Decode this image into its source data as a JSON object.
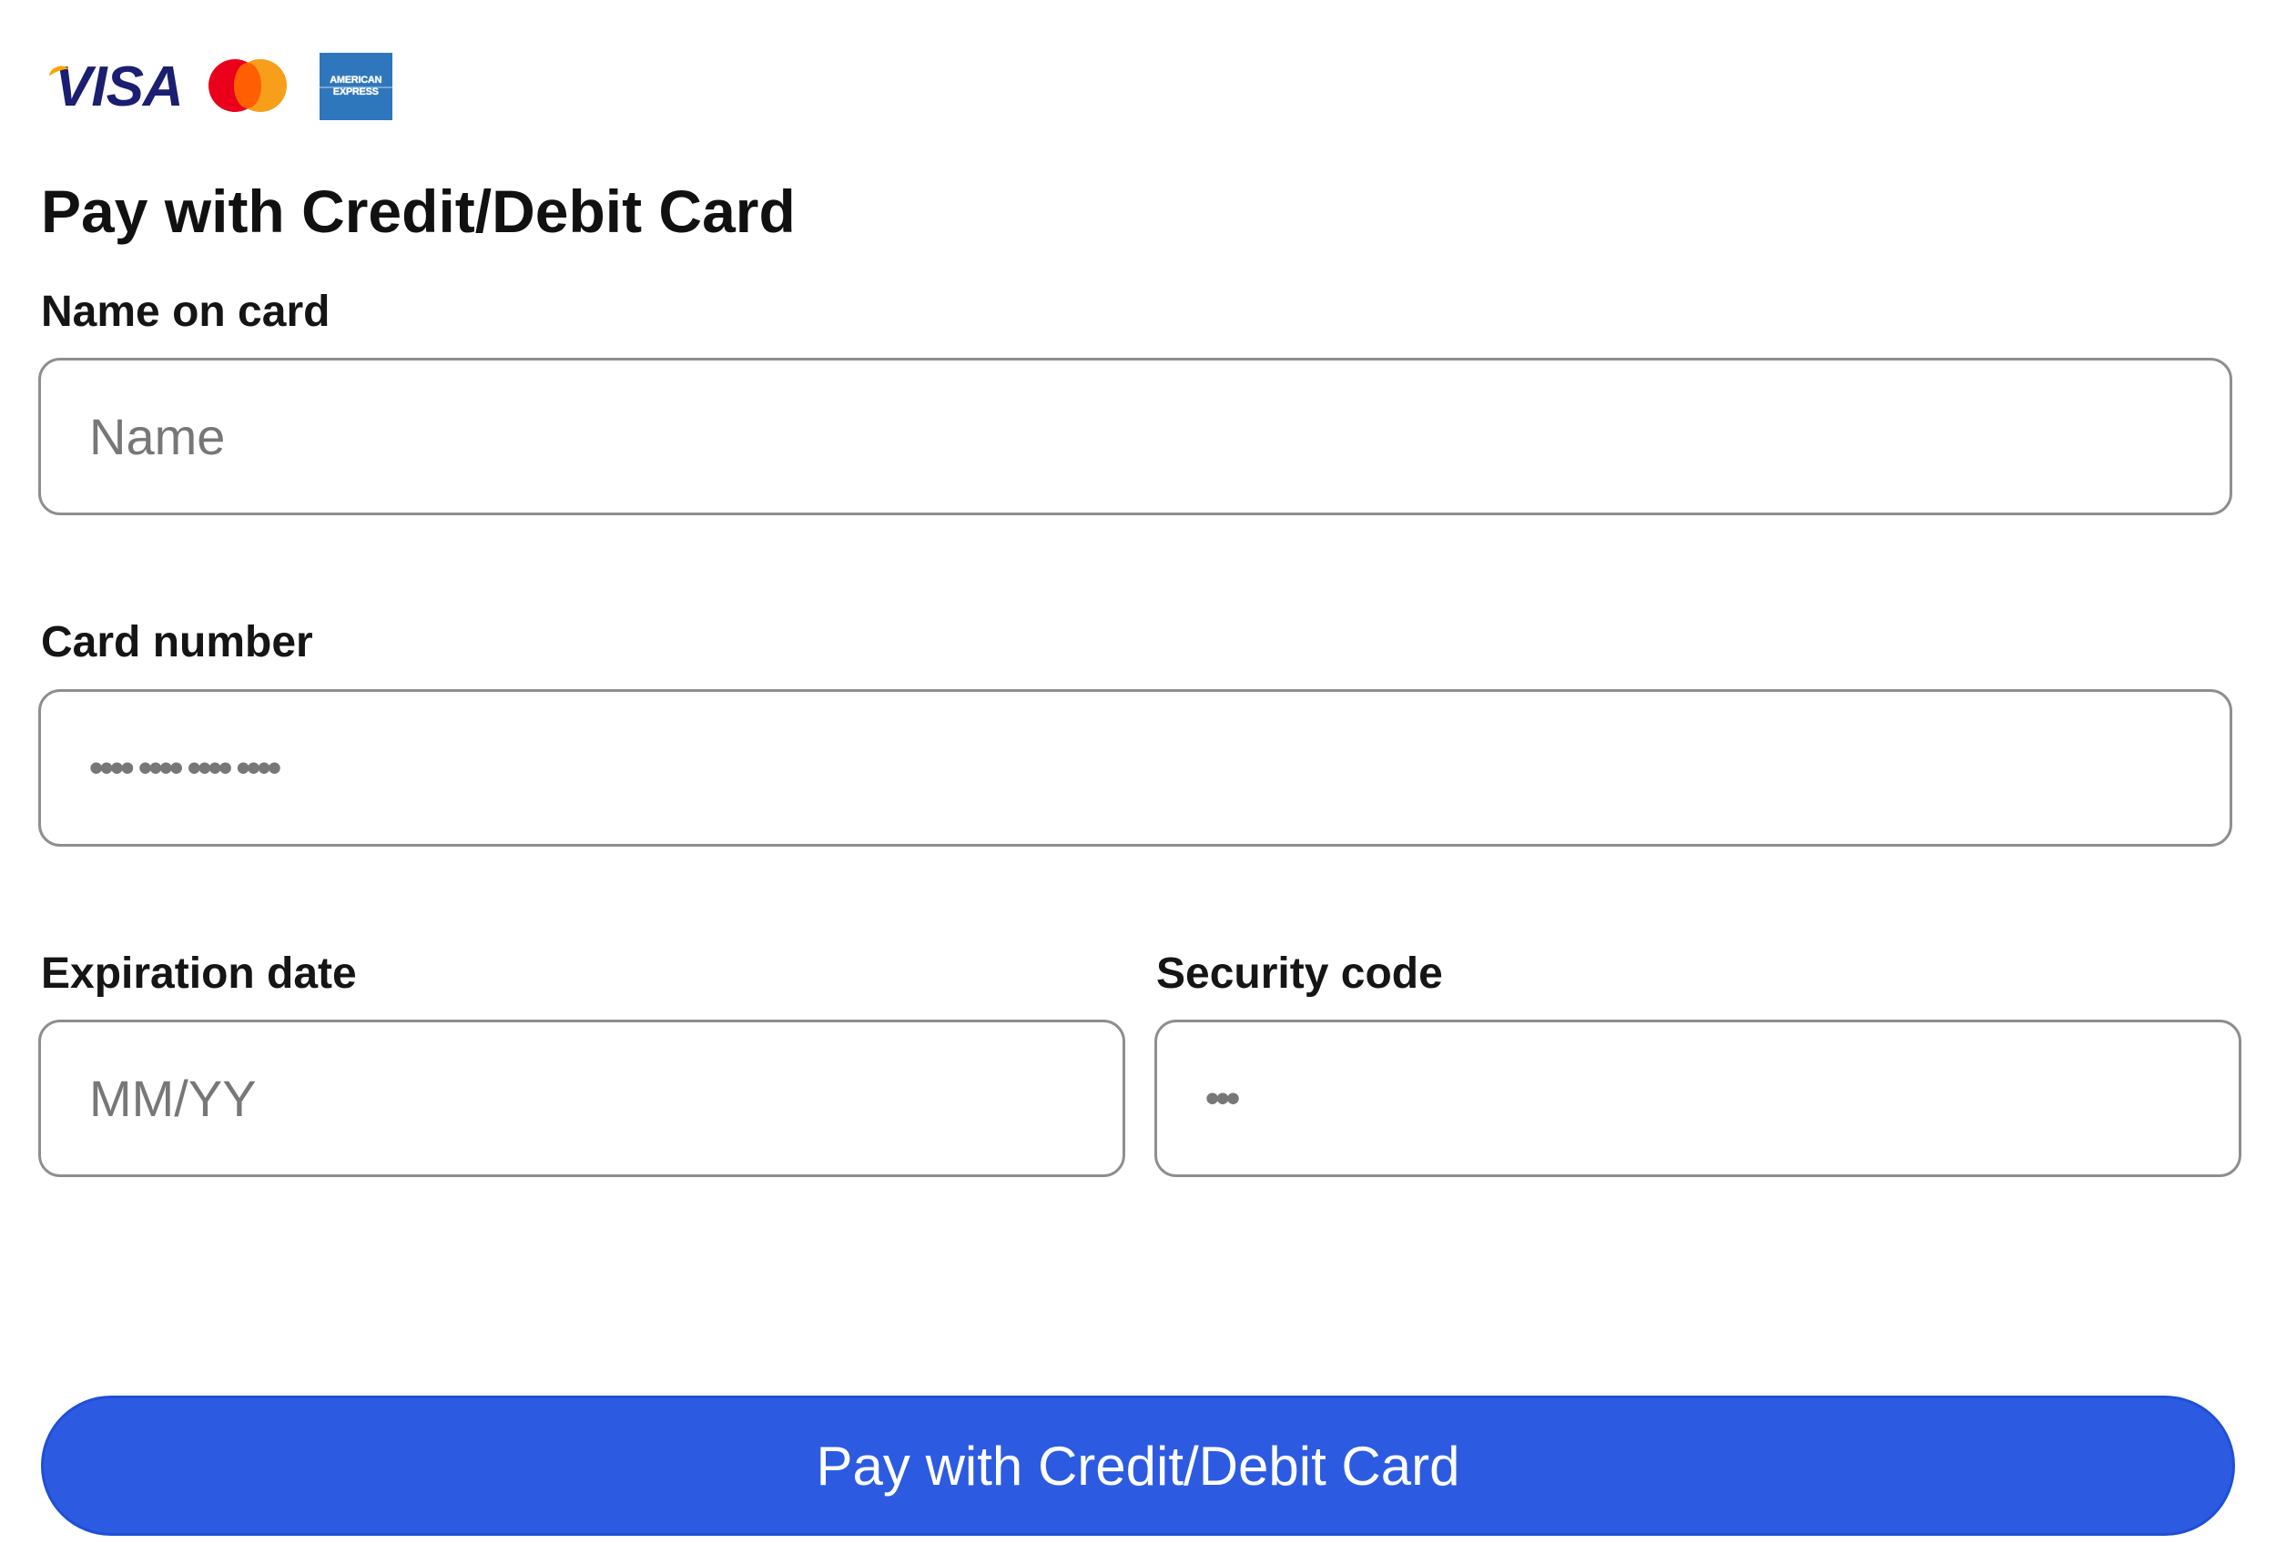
{
  "card_brands": {
    "visa": "VISA",
    "mastercard_icon": "mastercard-icon",
    "amex_line1": "AMERICAN",
    "amex_line2": "EXPRESS"
  },
  "title": "Pay with Credit/Debit Card",
  "fields": {
    "name": {
      "label": "Name on card",
      "placeholder": "Name",
      "value": ""
    },
    "card_number": {
      "label": "Card number",
      "placeholder": "•••• •••• •••• ••••",
      "value": ""
    },
    "expiration": {
      "label": "Expiration date",
      "placeholder": "MM/YY",
      "value": ""
    },
    "security_code": {
      "label": "Security code",
      "placeholder": "•••",
      "value": ""
    }
  },
  "submit": {
    "label": "Pay with Credit/Debit Card"
  },
  "colors": {
    "button_bg": "#2c5be2",
    "border": "#8e8e8e",
    "visa_blue": "#1a1f71",
    "amex_blue": "#2e77bc"
  }
}
